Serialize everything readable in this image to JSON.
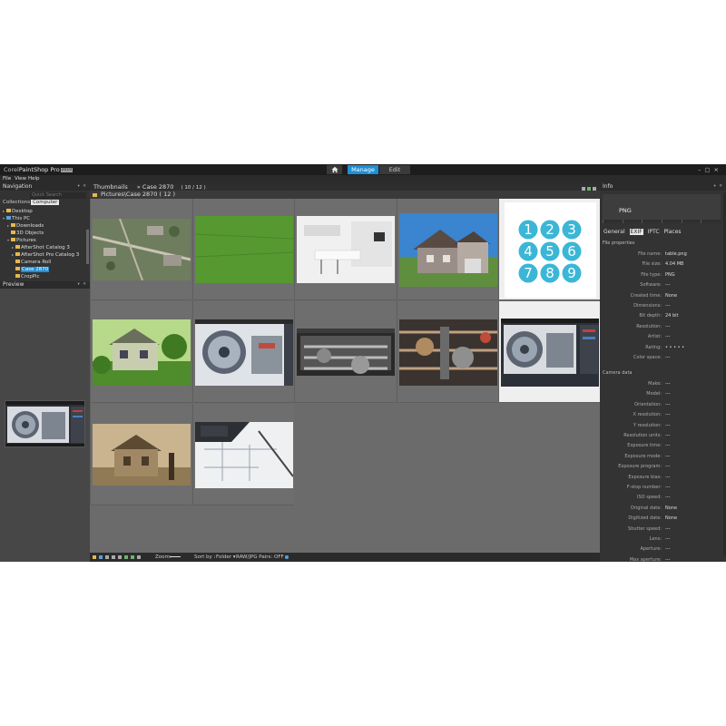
{
  "app": {
    "logo_corel": "Corel",
    "logo_name": "PaintShop Pro",
    "logo_version": "2019",
    "tabs": {
      "manage": "Manage",
      "edit": "Edit"
    },
    "window_controls": "–▢×"
  },
  "menu": [
    "File",
    "View",
    "Help"
  ],
  "navigation": {
    "title": "Navigation",
    "pin": "▾ ✕",
    "quick_search_placeholder": "Quick Search",
    "collections_label": "Collections",
    "computer_label": "Computer",
    "tree": [
      {
        "label": "Desktop",
        "indent": 0,
        "arrow": "▸",
        "icon": "folder"
      },
      {
        "label": "This PC",
        "indent": 0,
        "arrow": "▾",
        "icon": "pc"
      },
      {
        "label": "Downloads",
        "indent": 1,
        "arrow": "▸",
        "icon": "folder"
      },
      {
        "label": "3D Objects",
        "indent": 1,
        "arrow": "",
        "icon": "folder"
      },
      {
        "label": "Pictures",
        "indent": 1,
        "arrow": "▾",
        "icon": "folder"
      },
      {
        "label": "AfterShot Catalog 3",
        "indent": 2,
        "arrow": "▸",
        "icon": "folder"
      },
      {
        "label": "AfterShot Pro Catalog 3",
        "indent": 2,
        "arrow": "▸",
        "icon": "folder"
      },
      {
        "label": "Camera Roll",
        "indent": 2,
        "arrow": "",
        "icon": "folder"
      },
      {
        "label": "Case 2870",
        "indent": 2,
        "arrow": "",
        "icon": "folder",
        "selected": true
      },
      {
        "label": "CropPic",
        "indent": 2,
        "arrow": "",
        "icon": "folder"
      }
    ]
  },
  "preview": {
    "title": "Preview",
    "pin": "▾ ✕"
  },
  "thumbnails": {
    "title": "Thumbnails",
    "location": "Case 2870",
    "counter": "( 10 / 12 )",
    "path": "Pictures\\Case 2870 ( 12 )",
    "items": [
      {
        "name": "aerial-city-thumbnail",
        "kind": "aerial"
      },
      {
        "name": "grass-thumbnail",
        "kind": "grass"
      },
      {
        "name": "kitchen-thumbnail",
        "kind": "kitchen"
      },
      {
        "name": "house-thumbnail",
        "kind": "house"
      },
      {
        "name": "number-table-thumbnail",
        "kind": "numbers",
        "selected": true
      },
      {
        "name": "green-house-thumbnail",
        "kind": "greenhouse"
      },
      {
        "name": "turbine-thumbnail",
        "kind": "turbine"
      },
      {
        "name": "engine-screenshot-thumbnail",
        "kind": "engine1"
      },
      {
        "name": "engine-thumbnail",
        "kind": "engine2"
      },
      {
        "name": "turbine-screenshot-thumbnail",
        "kind": "turbine2",
        "selected": true
      },
      {
        "name": "old-house-thumbnail",
        "kind": "oldhouse"
      },
      {
        "name": "blueprint-laptop-thumbnail",
        "kind": "blueprint"
      }
    ],
    "numbers": [
      "1",
      "2",
      "3",
      "4",
      "5",
      "6",
      "7",
      "8",
      "9"
    ]
  },
  "bottombar": {
    "zoom_label": "Zoom:",
    "sort_label": "Sort by :",
    "sort_value": "Folder ▾",
    "raw_label": "RAW/JPG Pairs: OFF ▾"
  },
  "info": {
    "title": "Info",
    "pin": "▾ ✕",
    "preview_label": "PNG",
    "tabs": [
      "General",
      "EXIF",
      "IPTC",
      "Places"
    ],
    "active_tab": "EXIF",
    "file_section": "File properties",
    "file_props": [
      {
        "k": "File name:",
        "v": "table.png"
      },
      {
        "k": "File size:",
        "v": "4.04 MB"
      },
      {
        "k": "File type:",
        "v": "PNG"
      },
      {
        "k": "Software:",
        "v": "---"
      },
      {
        "k": "Created time:",
        "v": "None"
      },
      {
        "k": "Dimensions:",
        "v": "---"
      },
      {
        "k": "Bit depth:",
        "v": "24 bit"
      },
      {
        "k": "Resolution:",
        "v": "---"
      },
      {
        "k": "Artist:",
        "v": "---"
      },
      {
        "k": "Rating:",
        "v": "• • • • •"
      },
      {
        "k": "Color space:",
        "v": "---"
      }
    ],
    "camera_section": "Camera data",
    "camera_props": [
      {
        "k": "Make:",
        "v": "---"
      },
      {
        "k": "Model:",
        "v": "---"
      },
      {
        "k": "Orientation:",
        "v": "---"
      },
      {
        "k": "X resolution:",
        "v": "---"
      },
      {
        "k": "Y resolution:",
        "v": "---"
      },
      {
        "k": "Resolution units:",
        "v": "---"
      },
      {
        "k": "Exposure time:",
        "v": "---"
      },
      {
        "k": "Exposure mode:",
        "v": "---"
      },
      {
        "k": "Exposure program:",
        "v": "---"
      },
      {
        "k": "Exposure bias:",
        "v": "---"
      },
      {
        "k": "F-stop number:",
        "v": "---"
      },
      {
        "k": "ISO speed:",
        "v": "---"
      },
      {
        "k": "Original date:",
        "v": "None"
      },
      {
        "k": "Digitized date:",
        "v": "None"
      },
      {
        "k": "Shutter speed:",
        "v": "---"
      },
      {
        "k": "Lens:",
        "v": "---"
      },
      {
        "k": "Aperture:",
        "v": "---"
      },
      {
        "k": "Max aperture:",
        "v": "---"
      }
    ]
  },
  "colors": {
    "accent": "#1e8fd6",
    "number_circle": "#3bb6d6",
    "folder": "#e7b84a"
  }
}
